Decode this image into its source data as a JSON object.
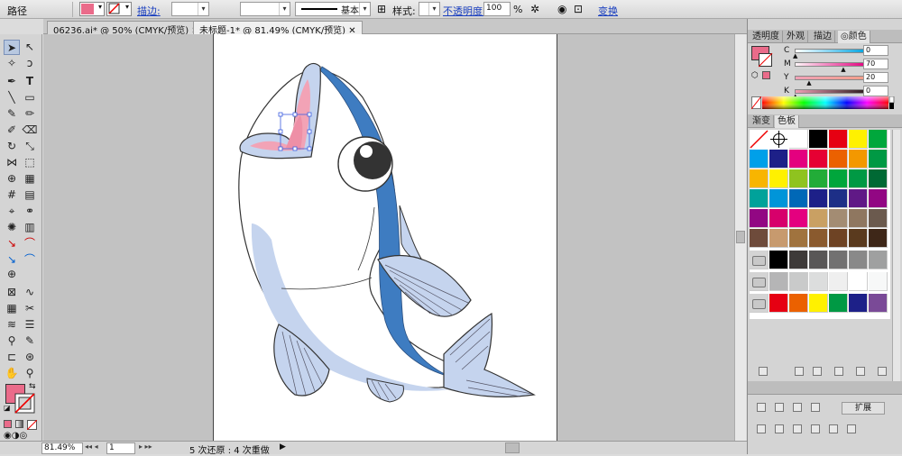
{
  "control_bar": {
    "object_label": "路径",
    "stroke_label": "描边:",
    "stroke_style_label": "基本",
    "style_label": "样式:",
    "opacity_label": "不透明度:",
    "opacity_value": "100",
    "opacity_unit": "%",
    "transform_label": "变换",
    "fill_color": "#ea6b8a"
  },
  "tabs": [
    {
      "label": "06236.ai* @ 50% (CMYK/预览)"
    },
    {
      "label": "未标题-1* @ 81.49% (CMYK/预览)"
    }
  ],
  "status": {
    "zoom": "81.49%",
    "page": "1",
    "history": "5 次还原 : 4 次重做"
  },
  "color_panel": {
    "tabs": [
      "透明度",
      "外观",
      "描边",
      "◎颜色"
    ],
    "channels": [
      {
        "name": "C",
        "value": "0",
        "pos": 0.0,
        "grad": "linear-gradient(90deg,#ffffff,#00a3e0)"
      },
      {
        "name": "M",
        "value": "70",
        "pos": 0.7,
        "grad": "linear-gradient(90deg,#fff6f8,#e3007f)"
      },
      {
        "name": "Y",
        "value": "20",
        "pos": 0.2,
        "grad": "linear-gradient(90deg,#f0a0b6,#f29f8a)"
      },
      {
        "name": "K",
        "value": "0",
        "pos": 0.0,
        "grad": "linear-gradient(90deg,#f0a0b6,#2b1a1e)"
      }
    ],
    "fill": "#ea6b8a"
  },
  "swatches_panel": {
    "tabs": [
      "渐变",
      "色板"
    ],
    "rows": [
      [
        "none",
        "reg",
        "#ffffff",
        "#000000",
        "#e60012",
        "#fff100",
        "#00a73c"
      ],
      [
        "#00a0e9",
        "#1d2088",
        "#e4007f",
        "#e60033",
        "#eb6100",
        "#f39800",
        "#009944"
      ],
      [
        "#f8b500",
        "#fff100",
        "#8fc31f",
        "#22ac38",
        "#00a63c",
        "#009944",
        "#006934"
      ],
      [
        "#00a29a",
        "#0095d9",
        "#0068b7",
        "#1d2088",
        "#1d2f87",
        "#601986",
        "#920783"
      ],
      [
        "#920783",
        "#d7006b",
        "#e4007f",
        "#c9a063",
        "#a38c73",
        "#8f7760",
        "#6b5a4e"
      ],
      [
        "#6e4b3b",
        "#c79a6e",
        "#a0733e",
        "#8a5a2e",
        "#6e4324",
        "#5a3a1e",
        "#3e2718"
      ],
      [
        "folder",
        "#000000",
        "#3e3a39",
        "#595757",
        "#727171",
        "#898989",
        "#9fa0a0"
      ],
      [
        "folder2",
        "#b5b5b6",
        "#c9caca",
        "#dcdddd",
        "#efefef",
        "#ffffff",
        "#f7f8f8"
      ],
      [
        "folder",
        "#e60012",
        "#eb6100",
        "#fff100",
        "#009944",
        "#1d2088",
        "#7a4a97"
      ]
    ]
  },
  "bottom_panel": {
    "expand_label": "扩展"
  }
}
